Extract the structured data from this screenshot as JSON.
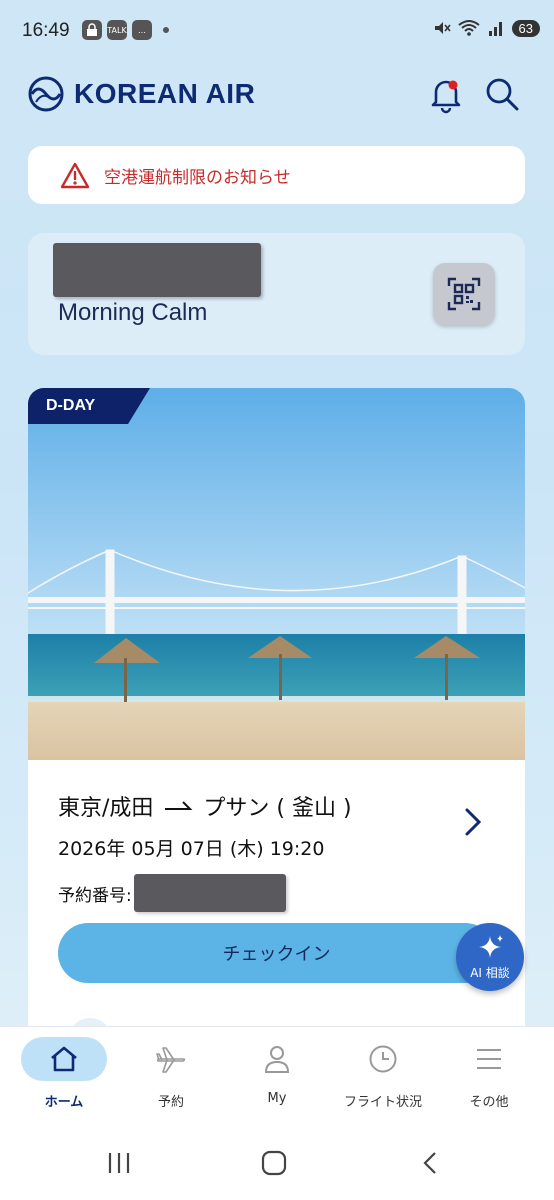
{
  "status_bar": {
    "time": "16:49",
    "talk_label": "TALK",
    "battery": "63"
  },
  "header": {
    "brand": "KOREAN AIR"
  },
  "notice": {
    "text": "空港運航制限のお知らせ"
  },
  "membership": {
    "tier": "Morning Calm"
  },
  "trip": {
    "badge": "D-DAY",
    "origin": "東京/成田",
    "destination": "プサン ( 釜山 )",
    "date": "2026年 05月 07日 (木) 19:20",
    "booking_label": "予約番号:",
    "checkin_label": "チェックイン"
  },
  "ai_fab": {
    "label": "AI 相談"
  },
  "bottom_nav": {
    "items": [
      {
        "label": "ホーム",
        "icon": "home-icon",
        "active": true
      },
      {
        "label": "予約",
        "icon": "plane-icon",
        "active": false
      },
      {
        "label": "My",
        "icon": "person-icon",
        "active": false
      },
      {
        "label": "フライト状況",
        "icon": "clock-icon",
        "active": false
      },
      {
        "label": "その他",
        "icon": "menu-icon",
        "active": false
      }
    ]
  },
  "colors": {
    "brand": "#0d2a72",
    "accent": "#5cb4e6",
    "alert": "#c62b2b",
    "notification_dot": "#e02020"
  }
}
